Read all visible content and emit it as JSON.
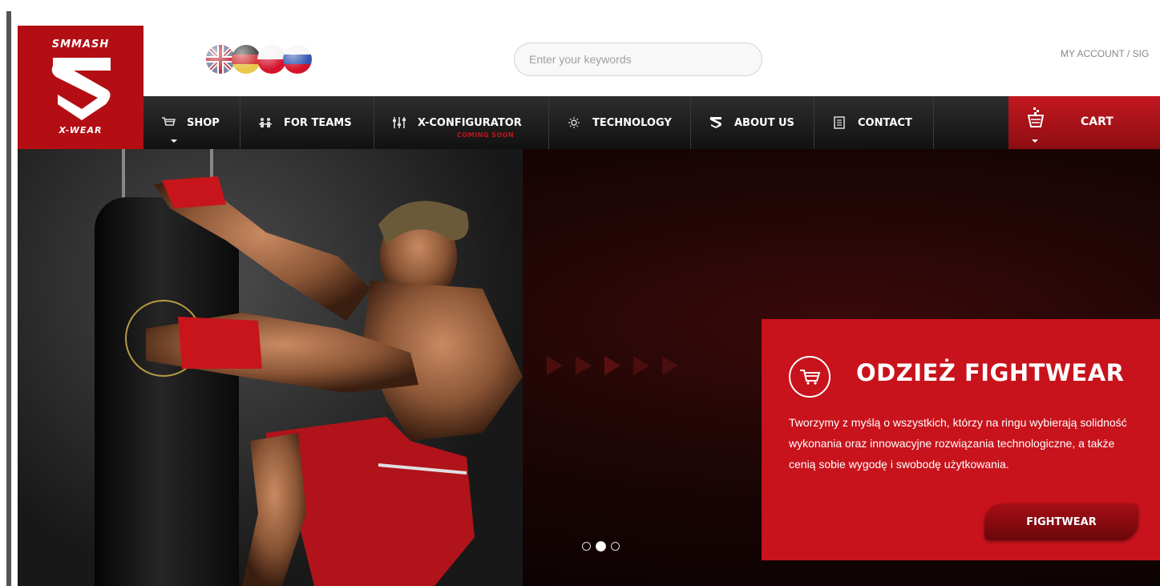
{
  "brand": {
    "name_top": "SMMASH",
    "name_bottom": "X-WEAR",
    "color": "#b30e14"
  },
  "header": {
    "languages": [
      {
        "name": "English",
        "icon": "uk-flag-icon"
      },
      {
        "name": "Deutsch",
        "icon": "german-flag-icon"
      },
      {
        "name": "Polski",
        "icon": "polish-flag-icon"
      },
      {
        "name": "Russian",
        "icon": "russian-flag-icon"
      }
    ],
    "search": {
      "placeholder": "Enter your keywords",
      "value": ""
    },
    "account": {
      "my_account": "MY ACCOUNT",
      "separator": "/",
      "sign": "SIG"
    }
  },
  "nav": {
    "items": [
      {
        "label": "SHOP",
        "icon": "cart-icon"
      },
      {
        "label": "FOR TEAMS",
        "icon": "team-icon"
      },
      {
        "label": "X-CONFIGURATOR",
        "icon": "sliders-icon",
        "note": "COMING SOON"
      },
      {
        "label": "TECHNOLOGY",
        "icon": "lightbulb-icon"
      },
      {
        "label": "ABOUT US",
        "icon": "smmash-logo-icon"
      },
      {
        "label": "CONTACT",
        "icon": "contact-card-icon"
      }
    ],
    "cart": {
      "label": "CART",
      "icon": "shopping-basket-icon"
    }
  },
  "hero": {
    "slide_count": 3,
    "active_slide": 2,
    "promo": {
      "title": "ODZIEŻ FIGHTWEAR",
      "text": "Tworzymy z myślą o wszystkich, którzy na ringu wybierają solidność wykonania oraz innowacyjne rozwiązania technologiczne, a także cenią sobie wygodę i swobodę użytkowania.",
      "button": "FIGHTWEAR",
      "color": "#c8131c"
    }
  }
}
